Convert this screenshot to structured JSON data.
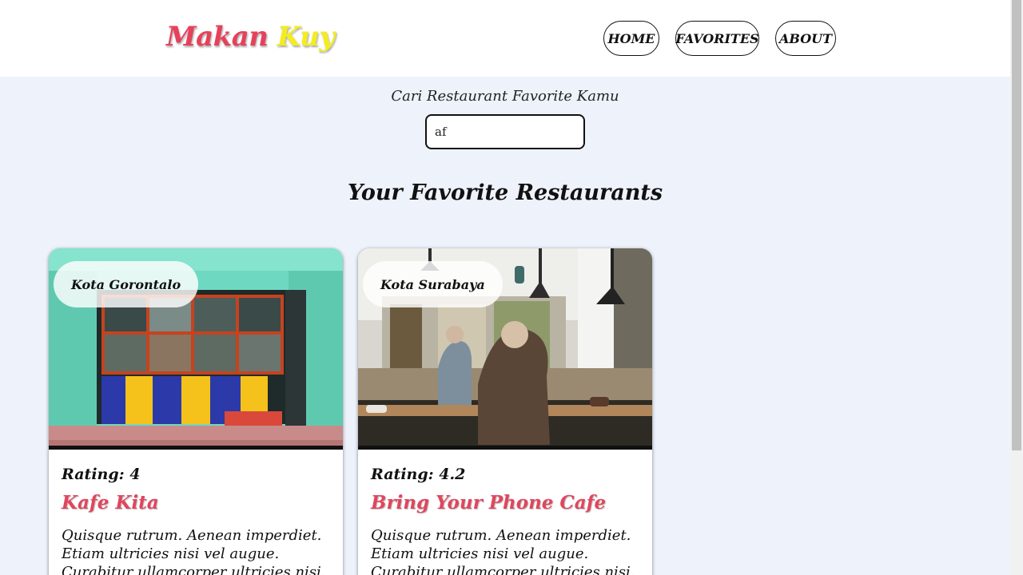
{
  "header": {
    "logo_part1": "Makan",
    "logo_part2": "Kuy",
    "nav": [
      {
        "label": "HOME"
      },
      {
        "label": "FAVORITES"
      },
      {
        "label": "ABOUT"
      }
    ]
  },
  "search": {
    "label": "Cari Restaurant Favorite Kamu",
    "value": "af"
  },
  "section": {
    "title": "Your Favorite Restaurants"
  },
  "restaurants": [
    {
      "city": "Kota Gorontalo",
      "rating": "Rating: 4",
      "name": "Kafe Kita",
      "description": "Quisque rutrum. Aenean imperdiet. Etiam ultricies nisi vel augue. Curabitur ullamcorper ultricies nisi. Nam eget dui."
    },
    {
      "city": "Kota Surabaya",
      "rating": "Rating: 4.2",
      "name": "Bring Your Phone Cafe",
      "description": "Quisque rutrum. Aenean imperdiet. Etiam ultricies nisi vel augue. Curabitur ullamcorper ultricies nisi. Nam eget dui."
    }
  ],
  "colors": {
    "brand_red": "#e8405a",
    "brand_yellow": "#f4ec1f",
    "page_bg": "#edf2fb"
  }
}
